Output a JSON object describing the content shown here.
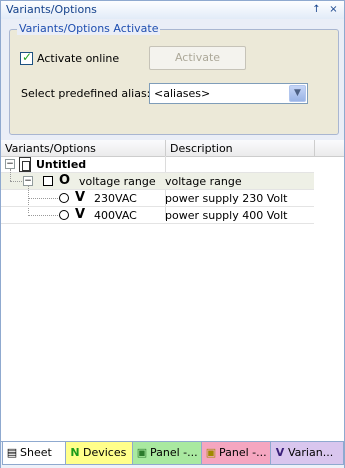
{
  "window": {
    "title": "Variants/Options",
    "pin_glyph": "↑",
    "close_glyph": "×"
  },
  "activate_group": {
    "legend": "Variants/Options Activate",
    "activate_online_label": "Activate online",
    "activate_online_checked": true,
    "activate_button_label": "Activate",
    "alias_label": "Select predefined alias:",
    "alias_value": "<aliases>"
  },
  "tree": {
    "columns": [
      "Variants/Options",
      "Description"
    ],
    "rows": [
      {
        "indicator": "",
        "name": "Untitled",
        "description": ""
      },
      {
        "indicator": "O",
        "name": "voltage range",
        "description": "voltage range"
      },
      {
        "indicator": "V",
        "name": "230VAC",
        "description": "power supply 230 Volt"
      },
      {
        "indicator": "V",
        "name": "400VAC",
        "description": "power supply 400 Volt"
      }
    ]
  },
  "tabs": [
    {
      "label": "Sheet",
      "icon": "sheet-icon",
      "glyph": "▤"
    },
    {
      "label": "Devices",
      "icon": "devices-icon",
      "glyph": "N"
    },
    {
      "label": "Panel -...",
      "icon": "panel-icon",
      "glyph": "▣"
    },
    {
      "label": "Panel -...",
      "icon": "panel-icon",
      "glyph": "▣"
    },
    {
      "label": "Varian...",
      "icon": "variants-icon",
      "glyph": "V"
    }
  ],
  "colors": {
    "title_text": "#15428b",
    "legend_text": "#1f4eb0",
    "checkmark": "#21a121",
    "tab_devices": "#ffff8a",
    "tab_panel1": "#a9e9a0",
    "tab_panel2": "#f5a6c0",
    "tab_variants": "#d9c6ee"
  }
}
